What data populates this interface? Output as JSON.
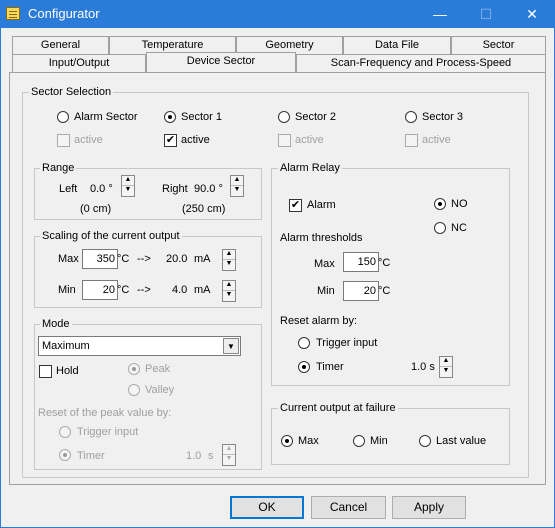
{
  "window": {
    "title": "Configurator",
    "minimize": "—",
    "maximize": "☐",
    "close": "✕"
  },
  "tabs_row1": [
    "General",
    "Temperature",
    "Geometry",
    "Data File",
    "Sector"
  ],
  "tabs_row2": [
    "Input/Output",
    "Device Sector",
    "Scan-Frequency and Process-Speed"
  ],
  "sector_selection": {
    "label": "Sector Selection",
    "options": [
      "Alarm Sector",
      "Sector 1",
      "Sector 2",
      "Sector 3"
    ],
    "active_label": "active",
    "selected": "Sector 1"
  },
  "range": {
    "label": "Range",
    "left_label": "Left",
    "left_value": "0.0 °",
    "left_sub": "(0 cm)",
    "right_label": "Right",
    "right_value": "90.0 °",
    "right_sub": "(250 cm)"
  },
  "scaling": {
    "label": "Scaling of the current output",
    "max_label": "Max",
    "max_value": "350",
    "max_unit": "°C",
    "max_arrow": "-->",
    "max_ma": "20.0",
    "min_label": "Min",
    "min_value": "20",
    "min_unit": "°C",
    "min_arrow": "-->",
    "min_ma": "4.0",
    "ma_unit": "mA"
  },
  "mode": {
    "label": "Mode",
    "selected": "Maximum",
    "hold": "Hold",
    "peak": "Peak",
    "valley": "Valley",
    "reset_label": "Reset of the peak value by:",
    "trigger_input": "Trigger input",
    "timer": "Timer",
    "timer_value": "1.0",
    "timer_unit": "s"
  },
  "alarm_relay": {
    "label": "Alarm Relay",
    "alarm": "Alarm",
    "no": "NO",
    "nc": "NC",
    "thresholds_label": "Alarm thresholds",
    "max_label": "Max",
    "max_value": "150",
    "min_label": "Min",
    "min_value": "20",
    "unit": "°C",
    "reset_label": "Reset alarm by:",
    "trigger_input": "Trigger input",
    "timer": "Timer",
    "timer_value": "1.0 s"
  },
  "current_failure": {
    "label": "Current output at failure",
    "options": [
      "Max",
      "Min",
      "Last value"
    ],
    "selected": "Max"
  },
  "buttons": {
    "ok": "OK",
    "cancel": "Cancel",
    "apply": "Apply"
  }
}
